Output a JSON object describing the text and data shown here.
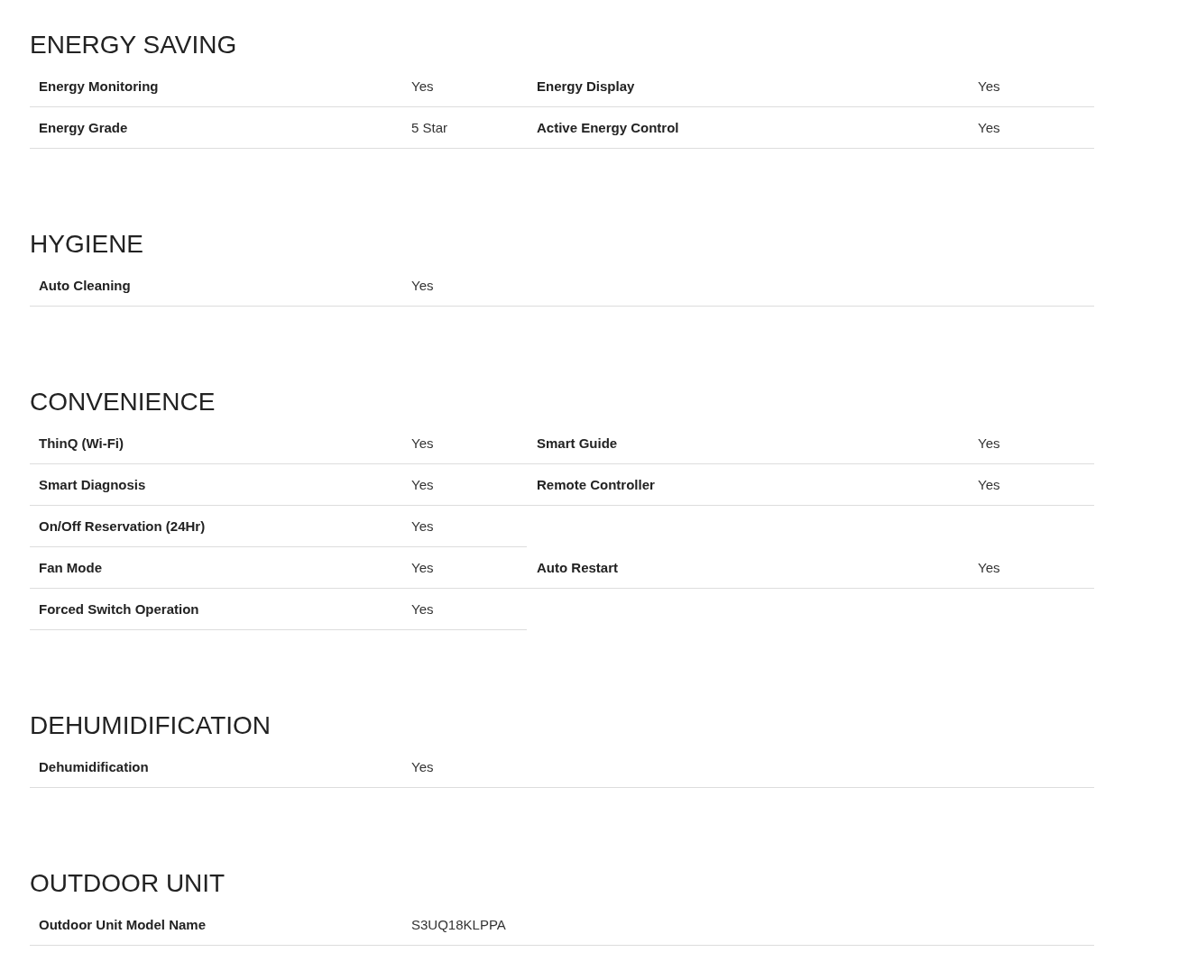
{
  "sections": [
    {
      "title": "ENERGY SAVING",
      "kind": "double",
      "rows": [
        {
          "left": {
            "label": "Energy Monitoring",
            "value": "Yes"
          },
          "right": {
            "label": "Energy Display",
            "value": "Yes"
          }
        },
        {
          "left": {
            "label": "Energy Grade",
            "value": "5 Star"
          },
          "right": {
            "label": "Active Energy Control",
            "value": "Yes"
          }
        }
      ]
    },
    {
      "title": "HYGIENE",
      "kind": "single",
      "rows": [
        {
          "left": {
            "label": "Auto Cleaning",
            "value": "Yes"
          }
        }
      ]
    },
    {
      "title": "CONVENIENCE",
      "kind": "double",
      "rows": [
        {
          "left": {
            "label": "ThinQ (Wi-Fi)",
            "value": "Yes"
          },
          "right": {
            "label": "Smart Guide",
            "value": "Yes"
          }
        },
        {
          "left": {
            "label": "Smart Diagnosis",
            "value": "Yes"
          },
          "right": {
            "label": "Remote Controller",
            "value": "Yes"
          }
        },
        {
          "left": {
            "label": "On/Off Reservation (24Hr)",
            "value": "Yes"
          }
        },
        {
          "left": {
            "label": "Fan Mode",
            "value": "Yes"
          },
          "right": {
            "label": "Auto Restart",
            "value": "Yes"
          }
        },
        {
          "left": {
            "label": "Forced Switch Operation",
            "value": "Yes"
          }
        }
      ]
    },
    {
      "title": "DEHUMIDIFICATION",
      "kind": "single",
      "rows": [
        {
          "left": {
            "label": "Dehumidification",
            "value": "Yes"
          }
        }
      ]
    },
    {
      "title": "OUTDOOR UNIT",
      "kind": "single",
      "rows": [
        {
          "left": {
            "label": "Outdoor Unit Model Name",
            "value": "S3UQ18KLPPA"
          }
        }
      ]
    }
  ]
}
